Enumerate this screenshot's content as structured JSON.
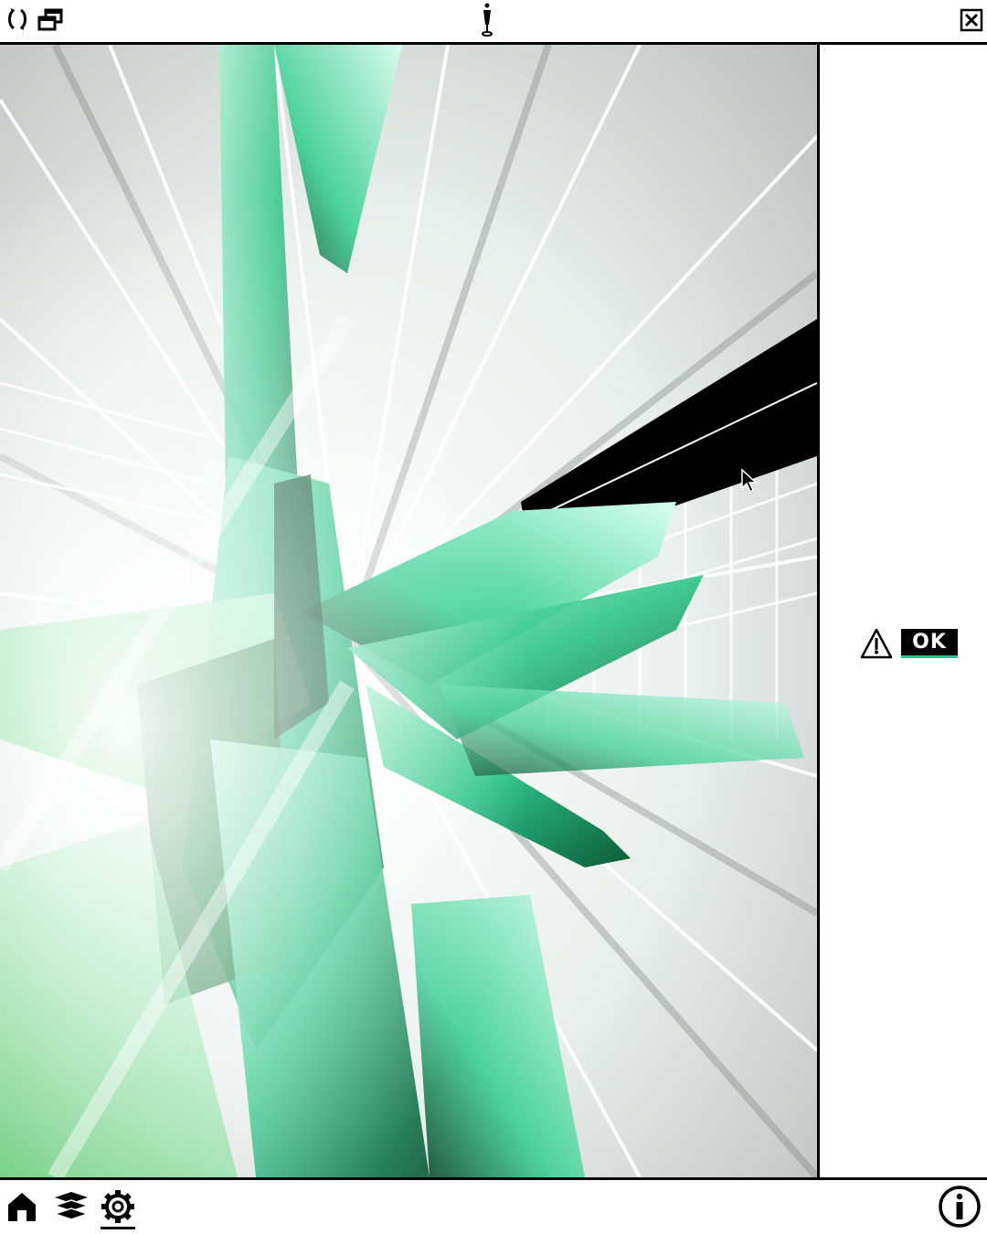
{
  "topbar": {
    "left_icons": [
      "refresh-icon",
      "window-restore-icon"
    ],
    "center_icon": "pin-icon",
    "right_icon": "close-icon"
  },
  "viewport": {
    "content": "artwork-image",
    "accent_colors": [
      "#2fc58a",
      "#1a8f5a",
      "#7ee0b6",
      "#0b3d25"
    ]
  },
  "sidepanel": {
    "status_icon": "warning-icon",
    "status_label": "OK"
  },
  "bottombar": {
    "nav_items": [
      {
        "icon": "home-icon",
        "active": false
      },
      {
        "icon": "layers-icon",
        "active": false
      },
      {
        "icon": "settings-icon",
        "active": true
      }
    ],
    "info_icon": "info-icon"
  }
}
